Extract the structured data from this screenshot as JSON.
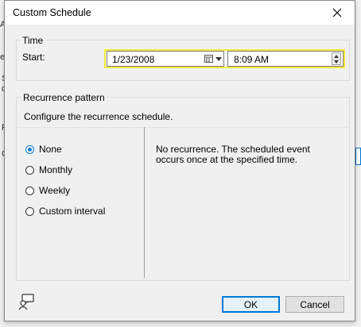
{
  "dialog": {
    "title": "Custom Schedule",
    "close_icon": "close-icon"
  },
  "time": {
    "group_label": "Time",
    "start_label": "Start:",
    "date_value": "1/23/2008",
    "time_value": "8:09 AM",
    "highlight_color": "#f2ec3a"
  },
  "recurrence": {
    "group_label": "Recurrence pattern",
    "instruction": "Configure the recurrence schedule.",
    "options": [
      {
        "label": "None",
        "checked": true
      },
      {
        "label": "Monthly",
        "checked": false
      },
      {
        "label": "Weekly",
        "checked": false
      },
      {
        "label": "Custom interval",
        "checked": false
      }
    ],
    "description": "No recurrence. The scheduled event occurs once at the specified time."
  },
  "buttons": {
    "ok": "OK",
    "cancel": "Cancel"
  },
  "background": {
    "fragments": [
      "A",
      "er",
      "S",
      "d",
      "F",
      "C"
    ]
  },
  "colors": {
    "accent": "#0078d7"
  }
}
